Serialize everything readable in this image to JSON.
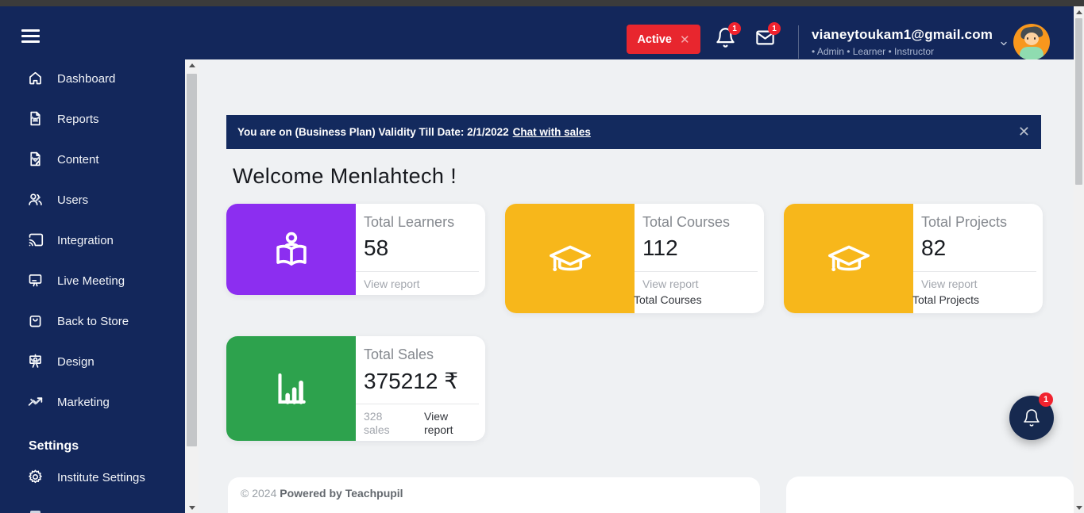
{
  "header": {
    "active_label": "Active",
    "active_close_label": "✕",
    "bell_badge": "1",
    "mail_badge": "1",
    "email": "vianeytoukam1@gmail.com",
    "roles": "• Admin • Learner • Instructor"
  },
  "sidebar": {
    "items": [
      {
        "label": "Dashboard"
      },
      {
        "label": "Reports"
      },
      {
        "label": "Content"
      },
      {
        "label": "Users"
      },
      {
        "label": "Integration"
      },
      {
        "label": "Live Meeting"
      },
      {
        "label": "Back to Store"
      },
      {
        "label": "Design"
      },
      {
        "label": "Marketing"
      }
    ],
    "settings_heading": "Settings",
    "settings_items": [
      {
        "label": "Institute Settings"
      }
    ]
  },
  "banner": {
    "message": "You are on (Business Plan) Validity Till Date: 2/1/2022",
    "link_label": "Chat with sales",
    "close_label": "✕"
  },
  "main": {
    "welcome": "Welcome Menlahtech !",
    "cards": [
      {
        "title": "Total Learners",
        "value": "58",
        "footer_link": "View report",
        "accent_color": "#8c2ef0"
      },
      {
        "title": "Total Courses",
        "value": "112",
        "footer_link": "View report",
        "footer_label": "Total Courses",
        "accent_color": "#f7b71b"
      },
      {
        "title": "Total Projects",
        "value": "82",
        "footer_link": "View report",
        "footer_label": "Total Projects",
        "accent_color": "#f7b71b"
      },
      {
        "title": "Total Sales",
        "value": "375212 ₹",
        "footer_sub": "328 sales",
        "footer_link": "View report",
        "accent_color": "#2da24d"
      }
    ]
  },
  "footer": {
    "copyright": "© 2024",
    "powered_by": "Powered by Teachpupil"
  },
  "floating_bell": {
    "badge": "1"
  },
  "theme": {
    "navy": "#13275b",
    "red": "#e8262e",
    "badge_red": "#f1222e",
    "content_bg": "#eff1f3"
  }
}
